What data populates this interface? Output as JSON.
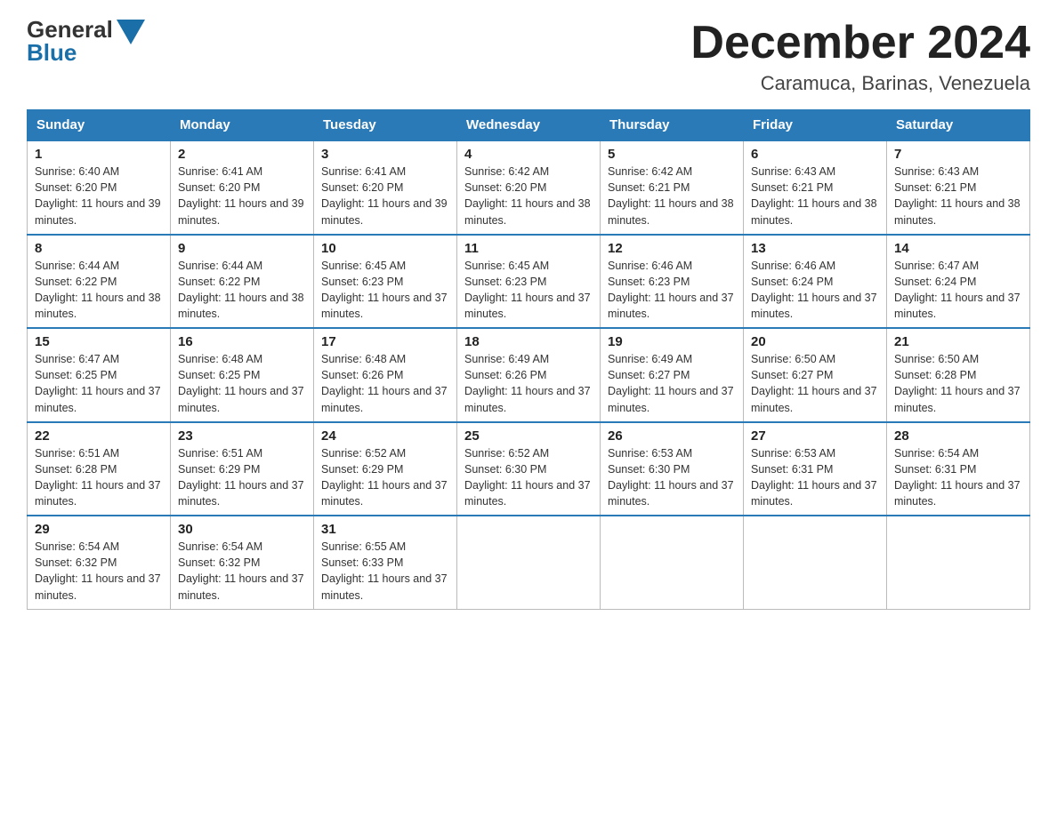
{
  "header": {
    "logo_general": "General",
    "logo_blue": "Blue",
    "month_title": "December 2024",
    "location": "Caramuca, Barinas, Venezuela"
  },
  "weekdays": [
    "Sunday",
    "Monday",
    "Tuesday",
    "Wednesday",
    "Thursday",
    "Friday",
    "Saturday"
  ],
  "weeks": [
    [
      {
        "day": "1",
        "sunrise": "6:40 AM",
        "sunset": "6:20 PM",
        "daylight": "11 hours and 39 minutes."
      },
      {
        "day": "2",
        "sunrise": "6:41 AM",
        "sunset": "6:20 PM",
        "daylight": "11 hours and 39 minutes."
      },
      {
        "day": "3",
        "sunrise": "6:41 AM",
        "sunset": "6:20 PM",
        "daylight": "11 hours and 39 minutes."
      },
      {
        "day": "4",
        "sunrise": "6:42 AM",
        "sunset": "6:20 PM",
        "daylight": "11 hours and 38 minutes."
      },
      {
        "day": "5",
        "sunrise": "6:42 AM",
        "sunset": "6:21 PM",
        "daylight": "11 hours and 38 minutes."
      },
      {
        "day": "6",
        "sunrise": "6:43 AM",
        "sunset": "6:21 PM",
        "daylight": "11 hours and 38 minutes."
      },
      {
        "day": "7",
        "sunrise": "6:43 AM",
        "sunset": "6:21 PM",
        "daylight": "11 hours and 38 minutes."
      }
    ],
    [
      {
        "day": "8",
        "sunrise": "6:44 AM",
        "sunset": "6:22 PM",
        "daylight": "11 hours and 38 minutes."
      },
      {
        "day": "9",
        "sunrise": "6:44 AM",
        "sunset": "6:22 PM",
        "daylight": "11 hours and 38 minutes."
      },
      {
        "day": "10",
        "sunrise": "6:45 AM",
        "sunset": "6:23 PM",
        "daylight": "11 hours and 37 minutes."
      },
      {
        "day": "11",
        "sunrise": "6:45 AM",
        "sunset": "6:23 PM",
        "daylight": "11 hours and 37 minutes."
      },
      {
        "day": "12",
        "sunrise": "6:46 AM",
        "sunset": "6:23 PM",
        "daylight": "11 hours and 37 minutes."
      },
      {
        "day": "13",
        "sunrise": "6:46 AM",
        "sunset": "6:24 PM",
        "daylight": "11 hours and 37 minutes."
      },
      {
        "day": "14",
        "sunrise": "6:47 AM",
        "sunset": "6:24 PM",
        "daylight": "11 hours and 37 minutes."
      }
    ],
    [
      {
        "day": "15",
        "sunrise": "6:47 AM",
        "sunset": "6:25 PM",
        "daylight": "11 hours and 37 minutes."
      },
      {
        "day": "16",
        "sunrise": "6:48 AM",
        "sunset": "6:25 PM",
        "daylight": "11 hours and 37 minutes."
      },
      {
        "day": "17",
        "sunrise": "6:48 AM",
        "sunset": "6:26 PM",
        "daylight": "11 hours and 37 minutes."
      },
      {
        "day": "18",
        "sunrise": "6:49 AM",
        "sunset": "6:26 PM",
        "daylight": "11 hours and 37 minutes."
      },
      {
        "day": "19",
        "sunrise": "6:49 AM",
        "sunset": "6:27 PM",
        "daylight": "11 hours and 37 minutes."
      },
      {
        "day": "20",
        "sunrise": "6:50 AM",
        "sunset": "6:27 PM",
        "daylight": "11 hours and 37 minutes."
      },
      {
        "day": "21",
        "sunrise": "6:50 AM",
        "sunset": "6:28 PM",
        "daylight": "11 hours and 37 minutes."
      }
    ],
    [
      {
        "day": "22",
        "sunrise": "6:51 AM",
        "sunset": "6:28 PM",
        "daylight": "11 hours and 37 minutes."
      },
      {
        "day": "23",
        "sunrise": "6:51 AM",
        "sunset": "6:29 PM",
        "daylight": "11 hours and 37 minutes."
      },
      {
        "day": "24",
        "sunrise": "6:52 AM",
        "sunset": "6:29 PM",
        "daylight": "11 hours and 37 minutes."
      },
      {
        "day": "25",
        "sunrise": "6:52 AM",
        "sunset": "6:30 PM",
        "daylight": "11 hours and 37 minutes."
      },
      {
        "day": "26",
        "sunrise": "6:53 AM",
        "sunset": "6:30 PM",
        "daylight": "11 hours and 37 minutes."
      },
      {
        "day": "27",
        "sunrise": "6:53 AM",
        "sunset": "6:31 PM",
        "daylight": "11 hours and 37 minutes."
      },
      {
        "day": "28",
        "sunrise": "6:54 AM",
        "sunset": "6:31 PM",
        "daylight": "11 hours and 37 minutes."
      }
    ],
    [
      {
        "day": "29",
        "sunrise": "6:54 AM",
        "sunset": "6:32 PM",
        "daylight": "11 hours and 37 minutes."
      },
      {
        "day": "30",
        "sunrise": "6:54 AM",
        "sunset": "6:32 PM",
        "daylight": "11 hours and 37 minutes."
      },
      {
        "day": "31",
        "sunrise": "6:55 AM",
        "sunset": "6:33 PM",
        "daylight": "11 hours and 37 minutes."
      },
      null,
      null,
      null,
      null
    ]
  ]
}
